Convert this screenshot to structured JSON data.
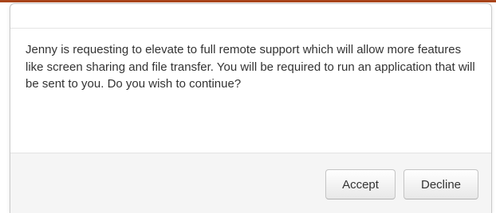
{
  "dialog": {
    "message": "Jenny is requesting to elevate to full remote support which will allow more features like screen sharing and file transfer. You will be required to run an application that will be sent to you. Do you wish to continue?",
    "accept_label": "Accept",
    "decline_label": "Decline"
  },
  "colors": {
    "accent_bar": "#a9441a",
    "footer_background": "#f5f5f5",
    "text": "#333333"
  }
}
